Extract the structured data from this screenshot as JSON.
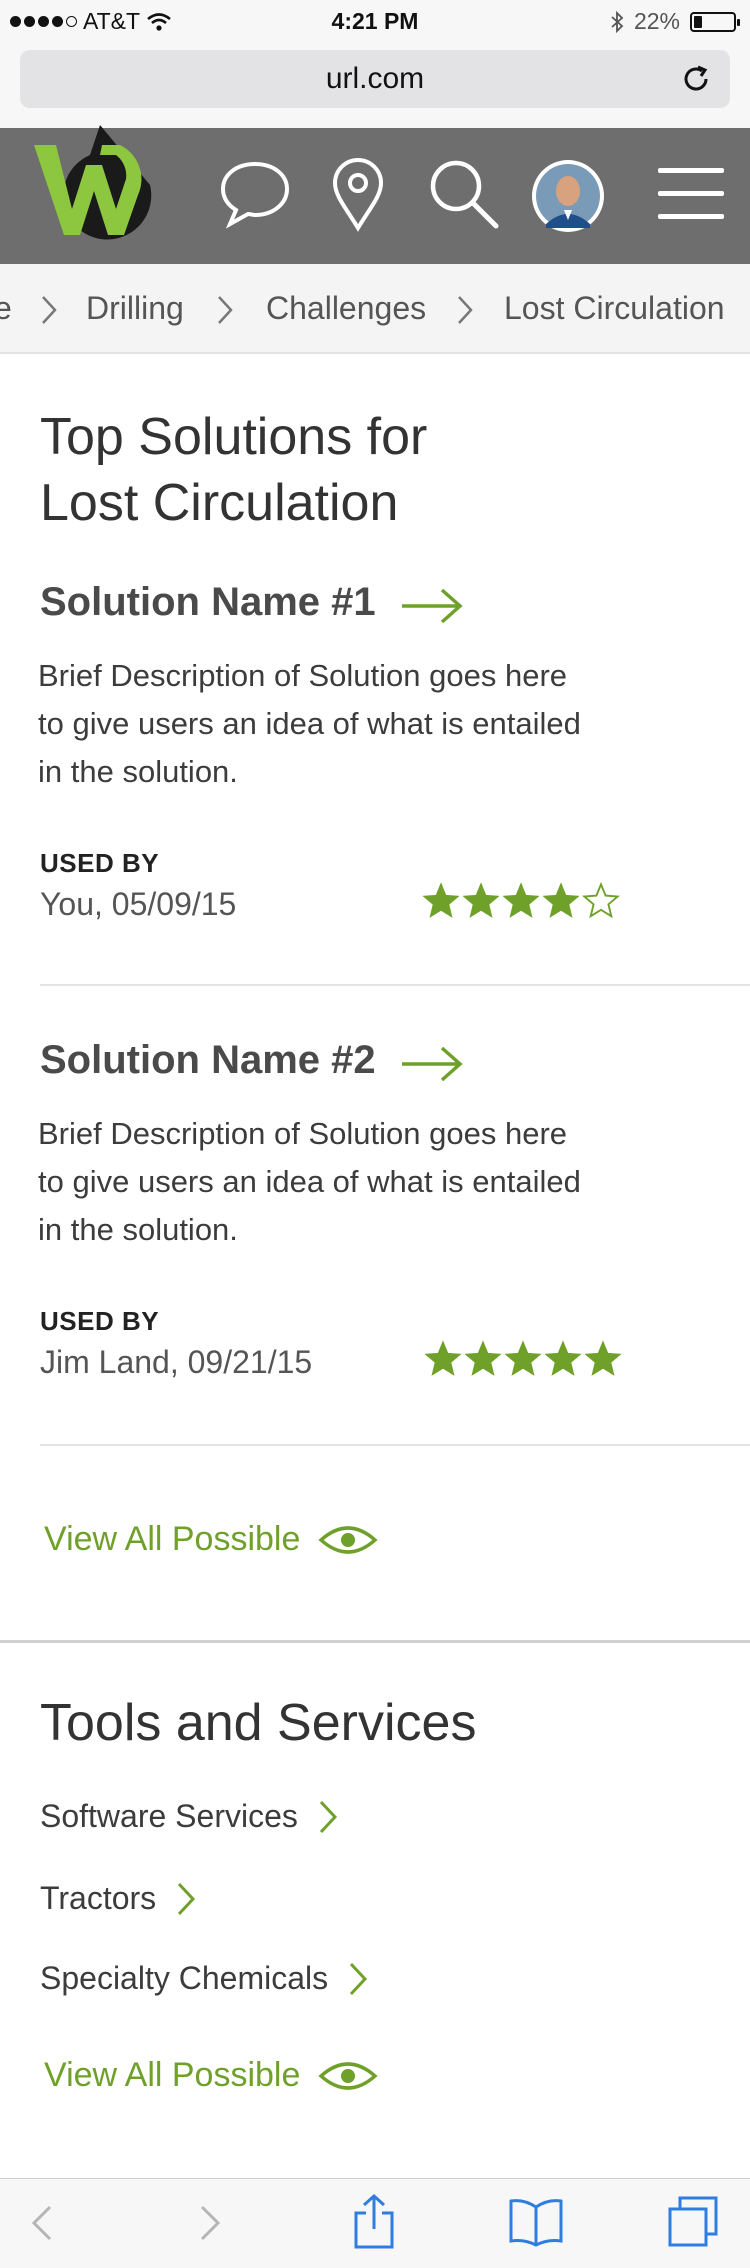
{
  "status_bar": {
    "carrier": "AT&T",
    "time": "4:21 PM",
    "battery": "22%",
    "battery_level": 0.22
  },
  "browser": {
    "url": "url.com"
  },
  "header": {
    "logo": "brand-logo",
    "icons": [
      "chat-icon",
      "location-pin-icon",
      "search-icon",
      "avatar",
      "menu-icon"
    ],
    "brand_colors": {
      "green": "#8dc63f",
      "dark": "#1a1a1a",
      "bar": "#6e6e6e"
    }
  },
  "breadcrumb": {
    "items": [
      "e",
      "Drilling",
      "Challenges",
      "Lost Circulation"
    ]
  },
  "solutions": {
    "title_line1": "Top Solutions for",
    "title_line2": "Lost Circulation",
    "items": [
      {
        "name": "Solution Name #1",
        "desc_line1": "Brief Description of Solution goes here",
        "desc_line2": "to give users an idea of what is entailed",
        "desc_line3": "in the solution.",
        "used_label": "USED BY",
        "used_value": "You, 05/09/15",
        "rating": 4
      },
      {
        "name": "Solution Name #2",
        "desc_line1": "Brief Description of Solution goes here",
        "desc_line2": "to give users an idea of what is entailed",
        "desc_line3": "in the solution.",
        "used_label": "USED BY",
        "used_value": "Jim Land, 09/21/15",
        "rating": 5
      }
    ],
    "view_all": "View All Possible"
  },
  "tools": {
    "title": "Tools and Services",
    "items": [
      "Software Services",
      "Tractors",
      "Specialty Chemicals"
    ],
    "view_all": "View All Possible"
  },
  "accent_color": "#6fa12a",
  "toolbar": {
    "icons": [
      "back-icon",
      "forward-icon",
      "share-icon",
      "bookmarks-icon",
      "tabs-icon"
    ]
  }
}
